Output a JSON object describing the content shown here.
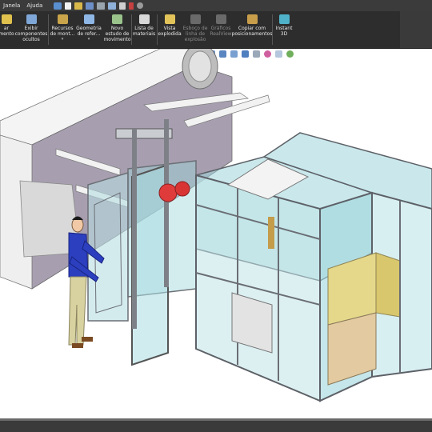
{
  "menu": [
    "Janela",
    "Ajuda"
  ],
  "quick_access_icons": [
    "home-icon",
    "new-document-icon",
    "open-folder-icon",
    "save-icon",
    "print-icon",
    "undo-icon",
    "select-arrow-icon",
    "rebuild-traffic-light-icon",
    "options-gear-icon"
  ],
  "ribbon": {
    "items": [
      {
        "label": "ar\nmento",
        "icon": "edit-component-icon"
      },
      {
        "label": "Exibir\ncomponentes\nocultos",
        "icon": "show-hidden-icon"
      },
      {
        "label": "Recursos\nde mont...",
        "icon": "assembly-features-icon",
        "caret": "▾"
      },
      {
        "label": "Geometria\nde refer...",
        "icon": "reference-geometry-icon",
        "caret": "▾"
      },
      {
        "label": "Novo\nestudo de\nmovimento",
        "icon": "motion-study-icon"
      },
      {
        "label": "Lista de\nmateriais",
        "icon": "bill-of-materials-icon"
      },
      {
        "label": "Vista\nexplodida",
        "icon": "exploded-view-icon"
      },
      {
        "label": "Esboço de\nlinha de\nexplosão",
        "icon": "explode-line-icon"
      },
      {
        "label": "Gráficos\nRealView",
        "icon": "realview-icon"
      },
      {
        "label": "Copiar com\nposicionamentos",
        "icon": "copy-mates-icon"
      },
      {
        "label": "Instant\n3D",
        "icon": "instant-3d-icon"
      }
    ]
  },
  "heads_up_toolbar": [
    "zoom-fit-icon",
    "zoom-area-icon",
    "previous-view-icon",
    "section-view-icon",
    "dynamic-annotation-icon",
    "view-orientation-icon",
    "display-style-icon",
    "hide-show-icon",
    "edit-appearance-icon",
    "scene-icon",
    "view-settings-icon"
  ],
  "colors": {
    "menubar": "#3b3b3b",
    "ribbon": "#2d2d2d",
    "glass": "#9ed6dc",
    "frame": "#b8bcc2",
    "wall": "#a79fb0",
    "person_shirt": "#2b3fbf"
  }
}
